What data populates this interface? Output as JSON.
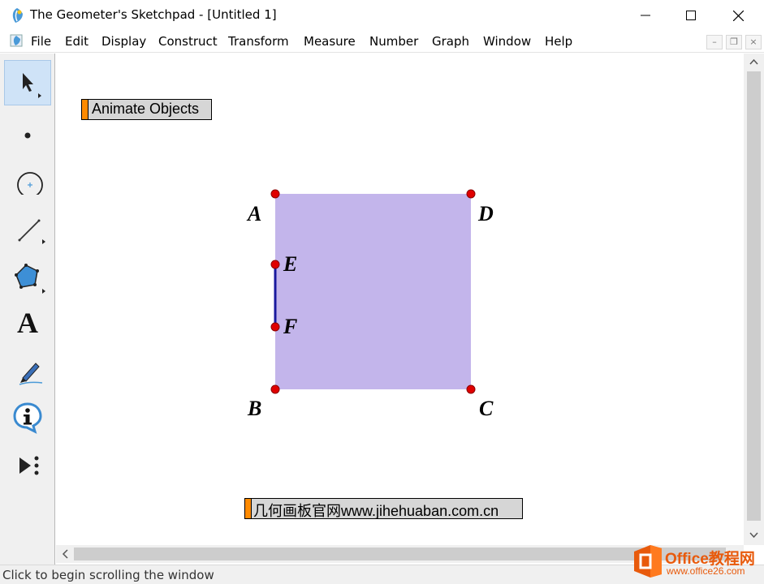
{
  "window": {
    "title": "The Geometer's Sketchpad - [Untitled 1]",
    "min_glyph": "—",
    "max_glyph": "☐",
    "close_glyph": "✕"
  },
  "menu": {
    "items": [
      "File",
      "Edit",
      "Display",
      "Construct",
      "Transform",
      "Measure",
      "Number",
      "Graph",
      "Window",
      "Help"
    ],
    "mdi_minimize": "–",
    "mdi_restore": "❐",
    "mdi_close": "×"
  },
  "toolbox": {
    "tools": [
      "arrow-tool",
      "point-tool",
      "compass-tool",
      "straightedge-tool",
      "polygon-tool",
      "text-tool",
      "marker-tool",
      "information-tool",
      "custom-tool"
    ],
    "text_tool_glyph": "A"
  },
  "sketch": {
    "buttons": {
      "animate_label": "Animate Objects",
      "link_label": "几何画板官网www.jihehuaban.com.cn"
    },
    "points": {
      "A": "A",
      "B": "B",
      "C": "C",
      "D": "D",
      "E": "E",
      "F": "F"
    },
    "colors": {
      "square_fill": "#c3b5eb",
      "segment": "#1a1a9e",
      "point": "#e00000",
      "button_bar": "#ff8a00"
    }
  },
  "scroll": {
    "left_arrow": "<",
    "up_arrow": "^",
    "down_arrow": "v"
  },
  "status": {
    "text": "Click to begin scrolling the window"
  },
  "watermark": {
    "brand": "Office教程网",
    "url": "www.office26.com"
  }
}
